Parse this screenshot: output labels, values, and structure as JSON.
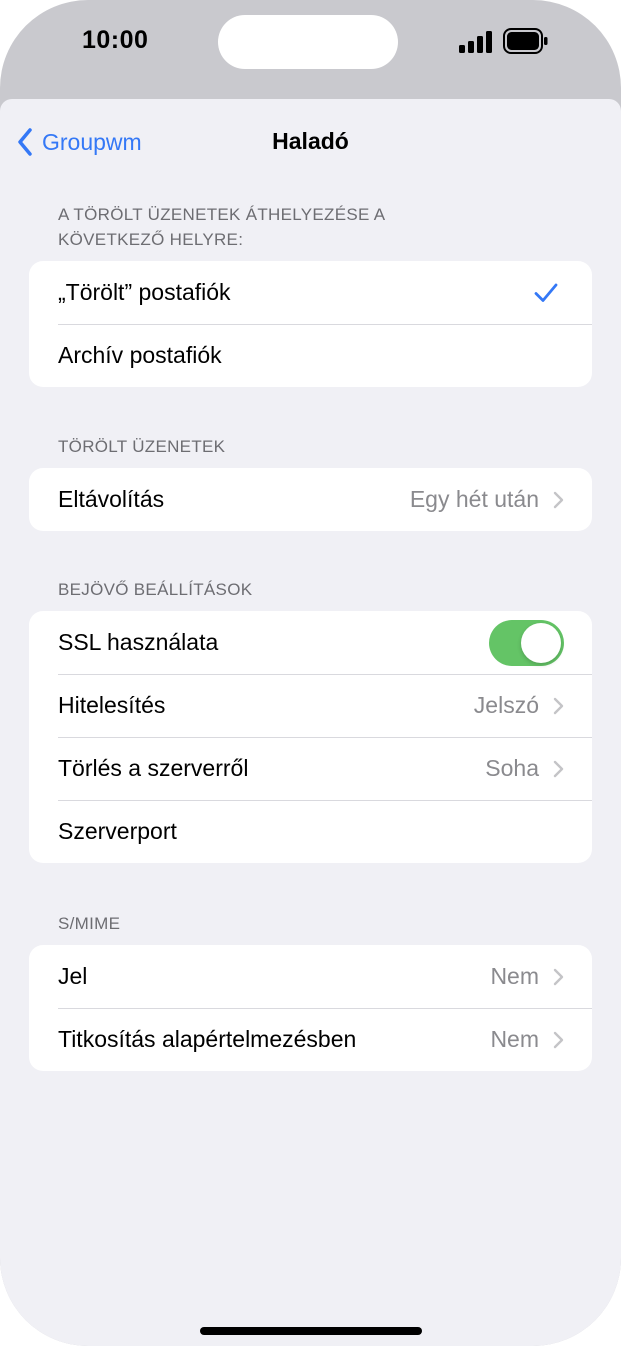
{
  "status_bar": {
    "time": "10:00",
    "signal_icon": "cellular-signal-icon",
    "battery_icon": "battery-icon"
  },
  "nav": {
    "back_label": "Groupwm",
    "title": "Haladó"
  },
  "sections": {
    "move_deleted": {
      "header": "A TÖRÖLT ÜZENETEK ÁTHELYEZÉSE A KÖVETKEZŐ HELYRE:",
      "options": [
        "„Törölt” postafiók",
        "Archív postafiók"
      ],
      "selected": "„Törölt” postafiók"
    },
    "deleted_messages": {
      "header": "TÖRÖLT ÜZENETEK",
      "remove_label": "Eltávolítás",
      "remove_value": "Egy hét után"
    },
    "incoming": {
      "header": "BEJÖVŐ BEÁLLÍTÁSOK",
      "ssl_label": "SSL használata",
      "ssl_on": true,
      "auth_label": "Hitelesítés",
      "auth_value": "Jelszó",
      "delete_server_label": "Törlés a szerverről",
      "delete_server_value": "Soha",
      "port_label": "Szerverport"
    },
    "smime": {
      "header": "S/MIME",
      "sign_label": "Jel",
      "sign_value": "Nem",
      "encrypt_label": "Titkosítás alapértelmezésben",
      "encrypt_value": "Nem"
    }
  },
  "colors": {
    "accent": "#3478f6",
    "toggle_on": "#64c466",
    "background": "#f0f0f5"
  }
}
